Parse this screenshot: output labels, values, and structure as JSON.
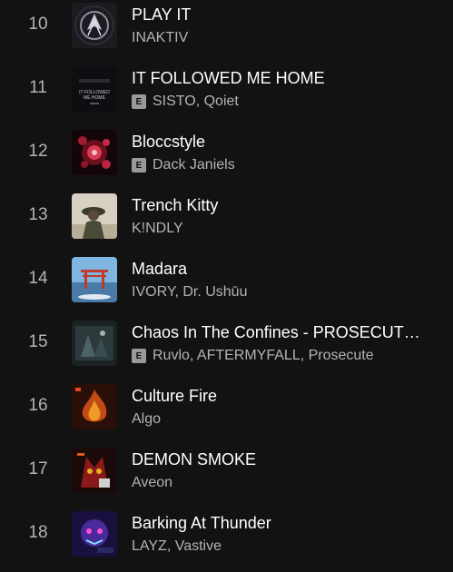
{
  "tracks": [
    {
      "number": "10",
      "title": "PLAY IT",
      "artists": "INAKTIV",
      "explicit": false,
      "cover_icon": "play-it-cover-icon"
    },
    {
      "number": "11",
      "title": "IT FOLLOWED ME HOME",
      "artists": "SISTO, Qoiet",
      "explicit": true,
      "explicit_label": "E",
      "cover_text": "IT FOLLOWED ME HOME",
      "cover_icon": "it-followed-me-home-cover-icon"
    },
    {
      "number": "12",
      "title": "Bloccstyle",
      "artists": "Dack Janiels",
      "explicit": true,
      "explicit_label": "E",
      "cover_icon": "bloccstyle-cover-icon"
    },
    {
      "number": "13",
      "title": "Trench Kitty",
      "artists": "K!NDLY",
      "explicit": false,
      "cover_icon": "trench-kitty-cover-icon"
    },
    {
      "number": "14",
      "title": "Madara",
      "artists": "IVORY, Dr. Ushūu",
      "explicit": false,
      "cover_icon": "madara-cover-icon"
    },
    {
      "number": "15",
      "title": "Chaos In The Confines - PROSECUT…",
      "artists": "Ruvlo, AFTERMYFALL, Prosecute",
      "explicit": true,
      "explicit_label": "E",
      "cover_icon": "chaos-in-the-confines-cover-icon"
    },
    {
      "number": "16",
      "title": "Culture Fire",
      "artists": "Algo",
      "explicit": false,
      "cover_icon": "culture-fire-cover-icon"
    },
    {
      "number": "17",
      "title": "DEMON SMOKE",
      "artists": "Aveon",
      "explicit": false,
      "cover_icon": "demon-smoke-cover-icon"
    },
    {
      "number": "18",
      "title": "Barking At Thunder",
      "artists": "LAYZ, Vastive",
      "explicit": false,
      "cover_icon": "barking-at-thunder-cover-icon"
    }
  ],
  "colors": {
    "background": "#121212",
    "title_text": "#ffffff",
    "secondary_text": "#b3b3b3",
    "explicit_badge": "#9a9a9a"
  }
}
